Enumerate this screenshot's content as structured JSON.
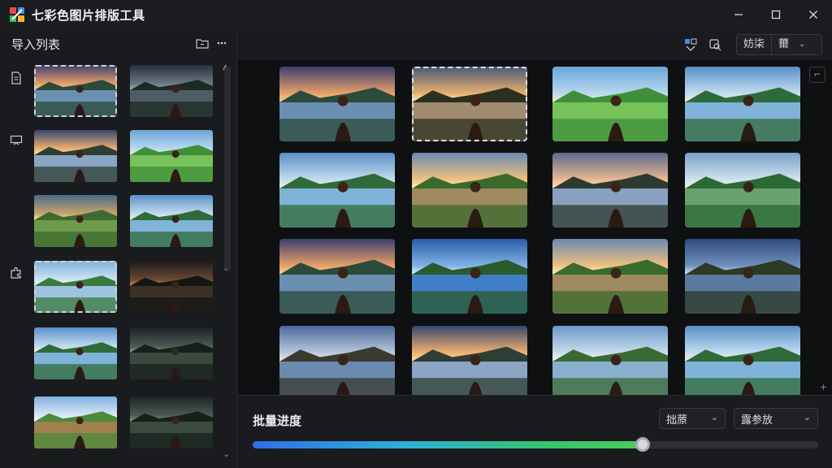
{
  "window": {
    "title": "七彩色图片排版工具",
    "controls": [
      "minimize",
      "maximize",
      "close"
    ]
  },
  "sidebar": {
    "title": "导入列表",
    "header_icons": [
      "folder-icon",
      "more-icon"
    ],
    "rail_icons": [
      "document-icon",
      "convert-icon",
      "puzzle-icon"
    ],
    "thumbnails": [
      {
        "scene": "sunset-portrait",
        "selected": true
      },
      {
        "scene": "lake-dusk",
        "selected": false
      },
      {
        "scene": "lake-sunset",
        "selected": false
      },
      {
        "scene": "meadow-portrait",
        "selected": false
      },
      {
        "scene": "field-portrait",
        "selected": false
      },
      {
        "scene": "lake-portrait",
        "selected": false
      },
      {
        "scene": "lake-portrait-green",
        "selected": true
      },
      {
        "scene": "dark-sunset",
        "selected": false
      },
      {
        "scene": "lake-portrait",
        "selected": false
      },
      {
        "scene": "dark-lake",
        "selected": false
      },
      {
        "scene": "road-meadow",
        "selected": false
      },
      {
        "scene": "dark-lake",
        "selected": false
      }
    ]
  },
  "toolbar": {
    "icons": [
      "layout-icon",
      "image-search-icon"
    ],
    "segment_labels": [
      "妨柒",
      "薾"
    ],
    "chevron": "chevron-down-icon"
  },
  "grid": {
    "cells": [
      {
        "scene": "sunset-portrait",
        "selected": false
      },
      {
        "scene": "lake-sunset-people",
        "selected": true
      },
      {
        "scene": "meadow-portrait",
        "selected": false
      },
      {
        "scene": "lake-portrait",
        "selected": false
      },
      {
        "scene": "lake-portrait",
        "selected": false
      },
      {
        "scene": "road-sunset",
        "selected": false
      },
      {
        "scene": "sunset-portrait-close",
        "selected": false
      },
      {
        "scene": "mountain-portrait",
        "selected": false
      },
      {
        "scene": "sunset-portrait",
        "selected": false
      },
      {
        "scene": "blue-lake",
        "selected": false
      },
      {
        "scene": "road-sunset",
        "selected": false
      },
      {
        "scene": "rock-lake",
        "selected": false
      },
      {
        "scene": "cliff-portrait",
        "selected": false
      },
      {
        "scene": "lake-sunset",
        "selected": false
      },
      {
        "scene": "lake-people",
        "selected": false
      },
      {
        "scene": "lake-portrait",
        "selected": false
      }
    ],
    "corner_icon": "expand-icon"
  },
  "bottom": {
    "title": "批量进度",
    "dropdown1": "拙蒝",
    "dropdown2": "露参放",
    "progress": 0.69
  },
  "colors": {
    "accent_blue": "#2f6fe8",
    "accent_green": "#4ccc5a",
    "panel": "#1a1b1e",
    "background": "#131416"
  }
}
